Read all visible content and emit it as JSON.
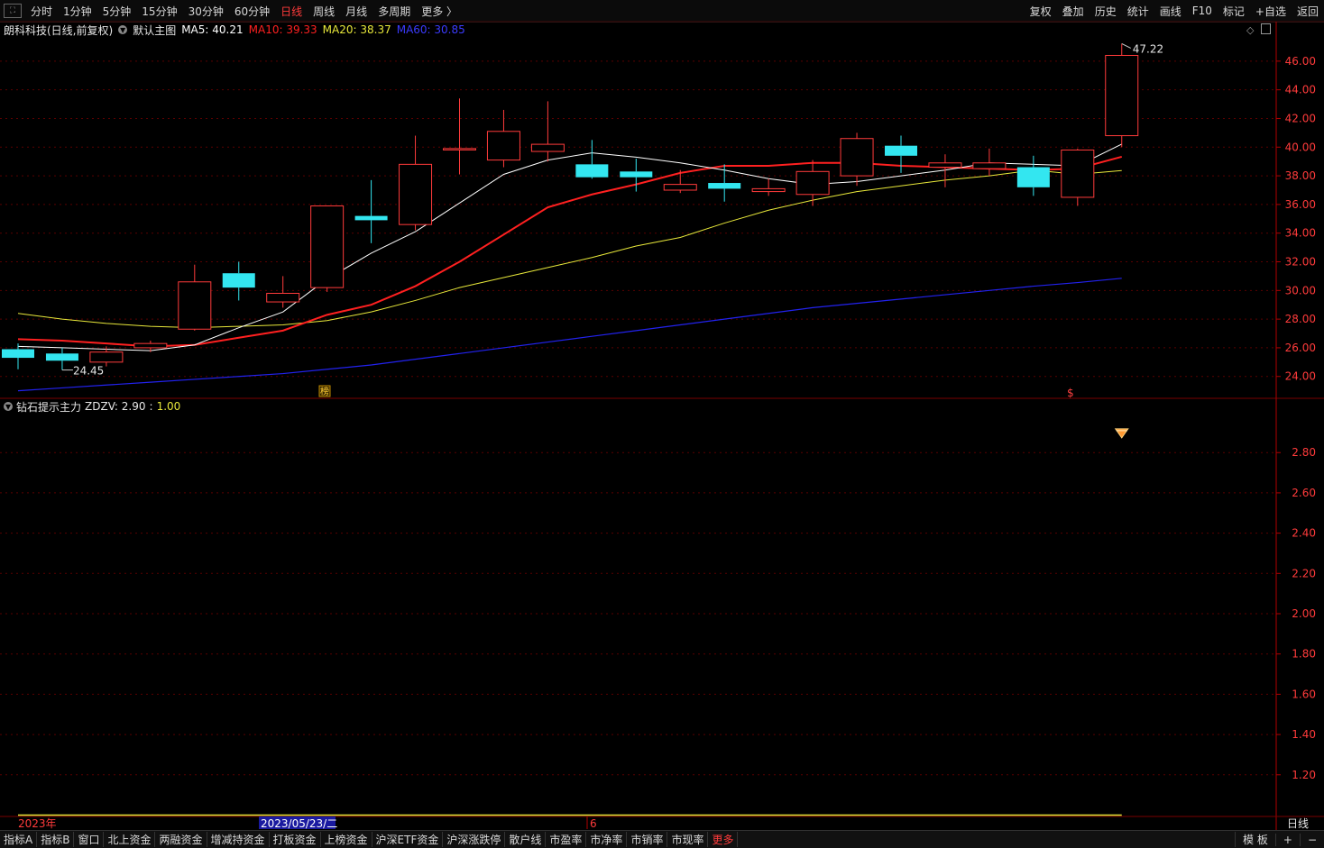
{
  "toolbar": {
    "periods": [
      "分时",
      "1分钟",
      "5分钟",
      "15分钟",
      "30分钟",
      "60分钟",
      "日线",
      "周线",
      "月线",
      "多周期",
      "更多 〉"
    ],
    "active_period": "日线",
    "tools": [
      "复权",
      "叠加",
      "历史",
      "统计",
      "画线",
      "F10",
      "标记",
      "+自选",
      "返回"
    ]
  },
  "main_legend": {
    "stock": "朗科科技(日线,前复权)",
    "template": "默认主图",
    "ma5": "MA5: 40.21",
    "ma10": "MA10: 39.33",
    "ma20": "MA20: 38.37",
    "ma60": "MA60: 30.85"
  },
  "sub_legend": {
    "name": "钻石提示主力",
    "zdzv": "ZDZV: 2.90",
    "sep": ":",
    "val": "1.00"
  },
  "markers": {
    "high_label": "47.22",
    "low_label": "24.45",
    "tag_bang": "榜",
    "tag_s": "$"
  },
  "time_axis": {
    "year": "2023年",
    "cursor_date": "2023/05/23/二",
    "month": "6",
    "period_label": "日线"
  },
  "bottom_tabs": [
    "指标A",
    "指标B",
    "窗口",
    "北上资金",
    "两融资金",
    "增减持资金",
    "打板资金",
    "上榜资金",
    "沪深ETF资金",
    "沪深涨跌停",
    "散户线",
    "市盈率",
    "市净率",
    "市销率",
    "市现率",
    "更多"
  ],
  "bottom_right": [
    "模 板",
    "+",
    "−"
  ],
  "colors": {
    "up": "#ff3b3b",
    "down": "#33e6f0",
    "ma5": "#ffffff",
    "ma10": "#ff2020",
    "ma20": "#e8e83a",
    "ma60": "#2222ee",
    "grid": "#5a0000",
    "axis_text": "#ff3b3b"
  },
  "chart_data": [
    {
      "type": "candlestick",
      "title": "朗科科技(日线,前复权)",
      "ylim": [
        22.6,
        47.5
      ],
      "y_ticks": [
        24,
        26,
        28,
        30,
        32,
        34,
        36,
        38,
        40,
        42,
        44,
        46
      ],
      "candles": [
        {
          "o": 25.9,
          "h": 26.3,
          "l": 24.5,
          "c": 25.3
        },
        {
          "o": 25.6,
          "h": 26.0,
          "l": 24.45,
          "c": 25.1
        },
        {
          "o": 25.0,
          "h": 26.1,
          "l": 24.7,
          "c": 25.7
        },
        {
          "o": 26.0,
          "h": 26.5,
          "l": 25.7,
          "c": 26.3
        },
        {
          "o": 27.3,
          "h": 31.8,
          "l": 27.2,
          "c": 30.6
        },
        {
          "o": 31.2,
          "h": 32.0,
          "l": 29.3,
          "c": 30.2
        },
        {
          "o": 29.2,
          "h": 31.0,
          "l": 28.8,
          "c": 29.8
        },
        {
          "o": 30.2,
          "h": 33.2,
          "l": 29.9,
          "c": 35.9
        },
        {
          "o": 35.2,
          "h": 37.7,
          "l": 33.3,
          "c": 34.9
        },
        {
          "o": 34.6,
          "h": 40.8,
          "l": 34.2,
          "c": 38.8
        },
        {
          "o": 39.9,
          "h": 43.4,
          "l": 38.1,
          "c": 39.9
        },
        {
          "o": 39.1,
          "h": 42.6,
          "l": 38.6,
          "c": 41.1
        },
        {
          "o": 39.7,
          "h": 43.2,
          "l": 39.0,
          "c": 40.2
        },
        {
          "o": 38.8,
          "h": 40.5,
          "l": 37.8,
          "c": 37.9
        },
        {
          "o": 38.3,
          "h": 39.2,
          "l": 36.9,
          "c": 37.9
        },
        {
          "o": 37.0,
          "h": 38.4,
          "l": 36.8,
          "c": 37.4
        },
        {
          "o": 37.5,
          "h": 38.8,
          "l": 36.2,
          "c": 37.1
        },
        {
          "o": 36.9,
          "h": 37.8,
          "l": 36.6,
          "c": 37.1
        },
        {
          "o": 36.7,
          "h": 39.1,
          "l": 35.9,
          "c": 38.3
        },
        {
          "o": 38.0,
          "h": 41.0,
          "l": 37.3,
          "c": 40.6
        },
        {
          "o": 40.1,
          "h": 40.8,
          "l": 38.2,
          "c": 39.4
        },
        {
          "o": 38.6,
          "h": 39.5,
          "l": 37.2,
          "c": 38.9
        },
        {
          "o": 38.5,
          "h": 39.9,
          "l": 38.0,
          "c": 38.9
        },
        {
          "o": 38.6,
          "h": 39.4,
          "l": 36.6,
          "c": 37.2
        },
        {
          "o": 36.5,
          "h": 39.9,
          "l": 35.9,
          "c": 39.8
        },
        {
          "o": 40.8,
          "h": 47.22,
          "l": 40.0,
          "c": 46.4
        }
      ],
      "ma5": [
        26.1,
        26.0,
        25.9,
        25.8,
        26.2,
        27.4,
        28.5,
        30.8,
        32.6,
        34.1,
        36.1,
        38.1,
        39.1,
        39.6,
        39.3,
        38.9,
        38.4,
        37.8,
        37.4,
        37.6,
        38.0,
        38.4,
        38.9,
        38.8,
        38.7,
        40.21
      ],
      "ma10": [
        26.6,
        26.5,
        26.3,
        26.1,
        26.2,
        26.7,
        27.2,
        28.3,
        29.0,
        30.3,
        32.0,
        33.9,
        35.8,
        36.7,
        37.4,
        38.2,
        38.7,
        38.7,
        38.9,
        38.9,
        38.7,
        38.6,
        38.5,
        38.4,
        38.5,
        39.33
      ],
      "ma20": [
        28.4,
        28.0,
        27.7,
        27.5,
        27.4,
        27.5,
        27.6,
        27.9,
        28.5,
        29.3,
        30.2,
        30.9,
        31.6,
        32.3,
        33.1,
        33.7,
        34.7,
        35.6,
        36.3,
        36.9,
        37.3,
        37.7,
        38.0,
        38.4,
        38.1,
        38.37
      ],
      "ma60": [
        23.0,
        23.2,
        23.4,
        23.6,
        23.8,
        24.0,
        24.2,
        24.5,
        24.8,
        25.2,
        25.6,
        26.0,
        26.4,
        26.8,
        27.2,
        27.6,
        28.0,
        28.4,
        28.8,
        29.1,
        29.4,
        29.7,
        30.0,
        30.3,
        30.55,
        30.85
      ]
    },
    {
      "type": "line",
      "title": "钻石提示主力",
      "ylim": [
        1.02,
        2.98
      ],
      "y_ticks": [
        1.2,
        1.4,
        1.6,
        1.8,
        2.0,
        2.2,
        2.4,
        2.6,
        2.8
      ],
      "series": [
        {
          "name": "ZDZV",
          "values": [
            1.0,
            1.0,
            1.0,
            1.0,
            1.0,
            1.0,
            1.0,
            1.0,
            1.0,
            1.0,
            1.0,
            1.0,
            1.0,
            1.0,
            1.0,
            1.0,
            1.0,
            1.0,
            1.0,
            1.0,
            1.0,
            1.0,
            1.0,
            1.0,
            1.0,
            1.0
          ]
        }
      ],
      "signal_index": 25
    }
  ]
}
